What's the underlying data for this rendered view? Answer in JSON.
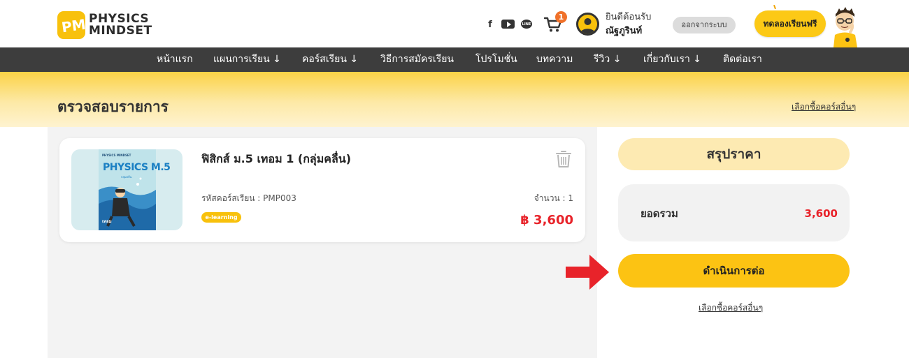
{
  "brand": {
    "line1": "PHYSICS",
    "line2": "MINDSET",
    "mark": "PM"
  },
  "header": {
    "social": [
      "f",
      "LINE"
    ],
    "cart_count": "1",
    "welcome": "ยินดีต้อนรับ",
    "username": "ณัฐภูรินท์",
    "logout_label": "ออกจากระบบ",
    "trial_label": "ทดลองเรียนฟรี"
  },
  "nav": {
    "items": [
      "หน้าแรก",
      "แผนการเรียน ↓",
      "คอร์สเรียน ↓",
      "วิธีการสมัครเรียน",
      "โปรโมชั่น",
      "บทความ",
      "รีวิว ↓",
      "เกี่ยวกับเรา ↓",
      "ติดต่อเรา"
    ]
  },
  "page": {
    "title": "ตรวจสอบรายการ",
    "more_courses_link": "เลือกซื้อคอร์สอื่นๆ"
  },
  "cart_item": {
    "name": "ฟิสิกส์ ม.5 เทอม 1 (กลุ่มคลื่น)",
    "code_label": "รหัสคอร์สเรียน : PMP003",
    "quantity_label": "จำนวน : 1",
    "type_badge": "e-learning",
    "price": "฿ 3,600",
    "cover": {
      "brand": "PHYSICS MINDSET",
      "title": "PHYSICS M.5",
      "subtitle": "กลุ่มคลื่น",
      "term": "เทอม"
    }
  },
  "summary": {
    "heading": "สรุปราคา",
    "total_label": "ยอดรวม",
    "total_value": "3,600",
    "proceed_label": "ดำเนินการต่อ",
    "more_courses_link": "เลือกซื้อคอร์สอื่นๆ"
  },
  "colors": {
    "accent_yellow": "#fcc313",
    "price_red": "#e8232a",
    "nav_bg": "#3d3d3d",
    "arrow_red": "#e8232a"
  },
  "icons": [
    "facebook-icon",
    "youtube-icon",
    "line-icon",
    "cart-icon",
    "avatar-icon",
    "trash-icon",
    "arrow-right-icon"
  ]
}
